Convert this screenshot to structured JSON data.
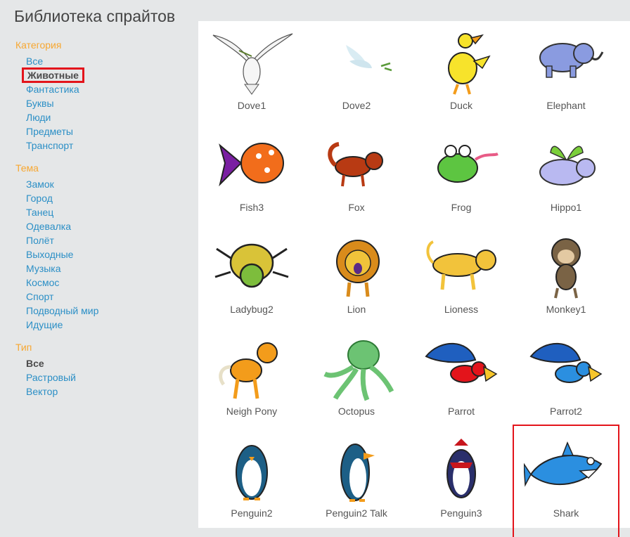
{
  "title": "Библиотека спрайтов",
  "sidebar": {
    "category": {
      "heading": "Категория",
      "items": [
        "Все",
        "Животные",
        "Фантастика",
        "Буквы",
        "Люди",
        "Предметы",
        "Транспорт"
      ],
      "selected": "Животные"
    },
    "theme": {
      "heading": "Тема",
      "items": [
        "Замок",
        "Город",
        "Танец",
        "Одевалка",
        "Полёт",
        "Выходные",
        "Музыка",
        "Космос",
        "Спорт",
        "Подводный мир",
        "Идущие"
      ]
    },
    "type": {
      "heading": "Тип",
      "items": [
        "Все",
        "Растровый",
        "Вектор"
      ],
      "selected": "Все"
    }
  },
  "sprites": [
    {
      "name": "Dove1",
      "icon": "dove-icon"
    },
    {
      "name": "Dove2",
      "icon": "dove-sketch-icon"
    },
    {
      "name": "Duck",
      "icon": "duck-icon"
    },
    {
      "name": "Elephant",
      "icon": "elephant-icon"
    },
    {
      "name": "Fish3",
      "icon": "fish-icon"
    },
    {
      "name": "Fox",
      "icon": "fox-icon"
    },
    {
      "name": "Frog",
      "icon": "frog-icon"
    },
    {
      "name": "Hippo1",
      "icon": "hippo-icon"
    },
    {
      "name": "Ladybug2",
      "icon": "ladybug-icon"
    },
    {
      "name": "Lion",
      "icon": "lion-icon"
    },
    {
      "name": "Lioness",
      "icon": "lioness-icon"
    },
    {
      "name": "Monkey1",
      "icon": "monkey-icon"
    },
    {
      "name": "Neigh Pony",
      "icon": "pony-icon"
    },
    {
      "name": "Octopus",
      "icon": "octopus-icon"
    },
    {
      "name": "Parrot",
      "icon": "parrot-icon"
    },
    {
      "name": "Parrot2",
      "icon": "parrot-icon"
    },
    {
      "name": "Penguin2",
      "icon": "penguin-icon"
    },
    {
      "name": "Penguin2 Talk",
      "icon": "penguin-icon"
    },
    {
      "name": "Penguin3",
      "icon": "penguin-scarf-icon"
    },
    {
      "name": "Shark",
      "icon": "shark-icon"
    }
  ],
  "selected_sprite": "Shark",
  "colors": {
    "heading": "#f7a731",
    "link": "#2b8fc6",
    "highlight": "#e3141b",
    "panel": "#ffffff",
    "background": "#e5e7e8"
  }
}
